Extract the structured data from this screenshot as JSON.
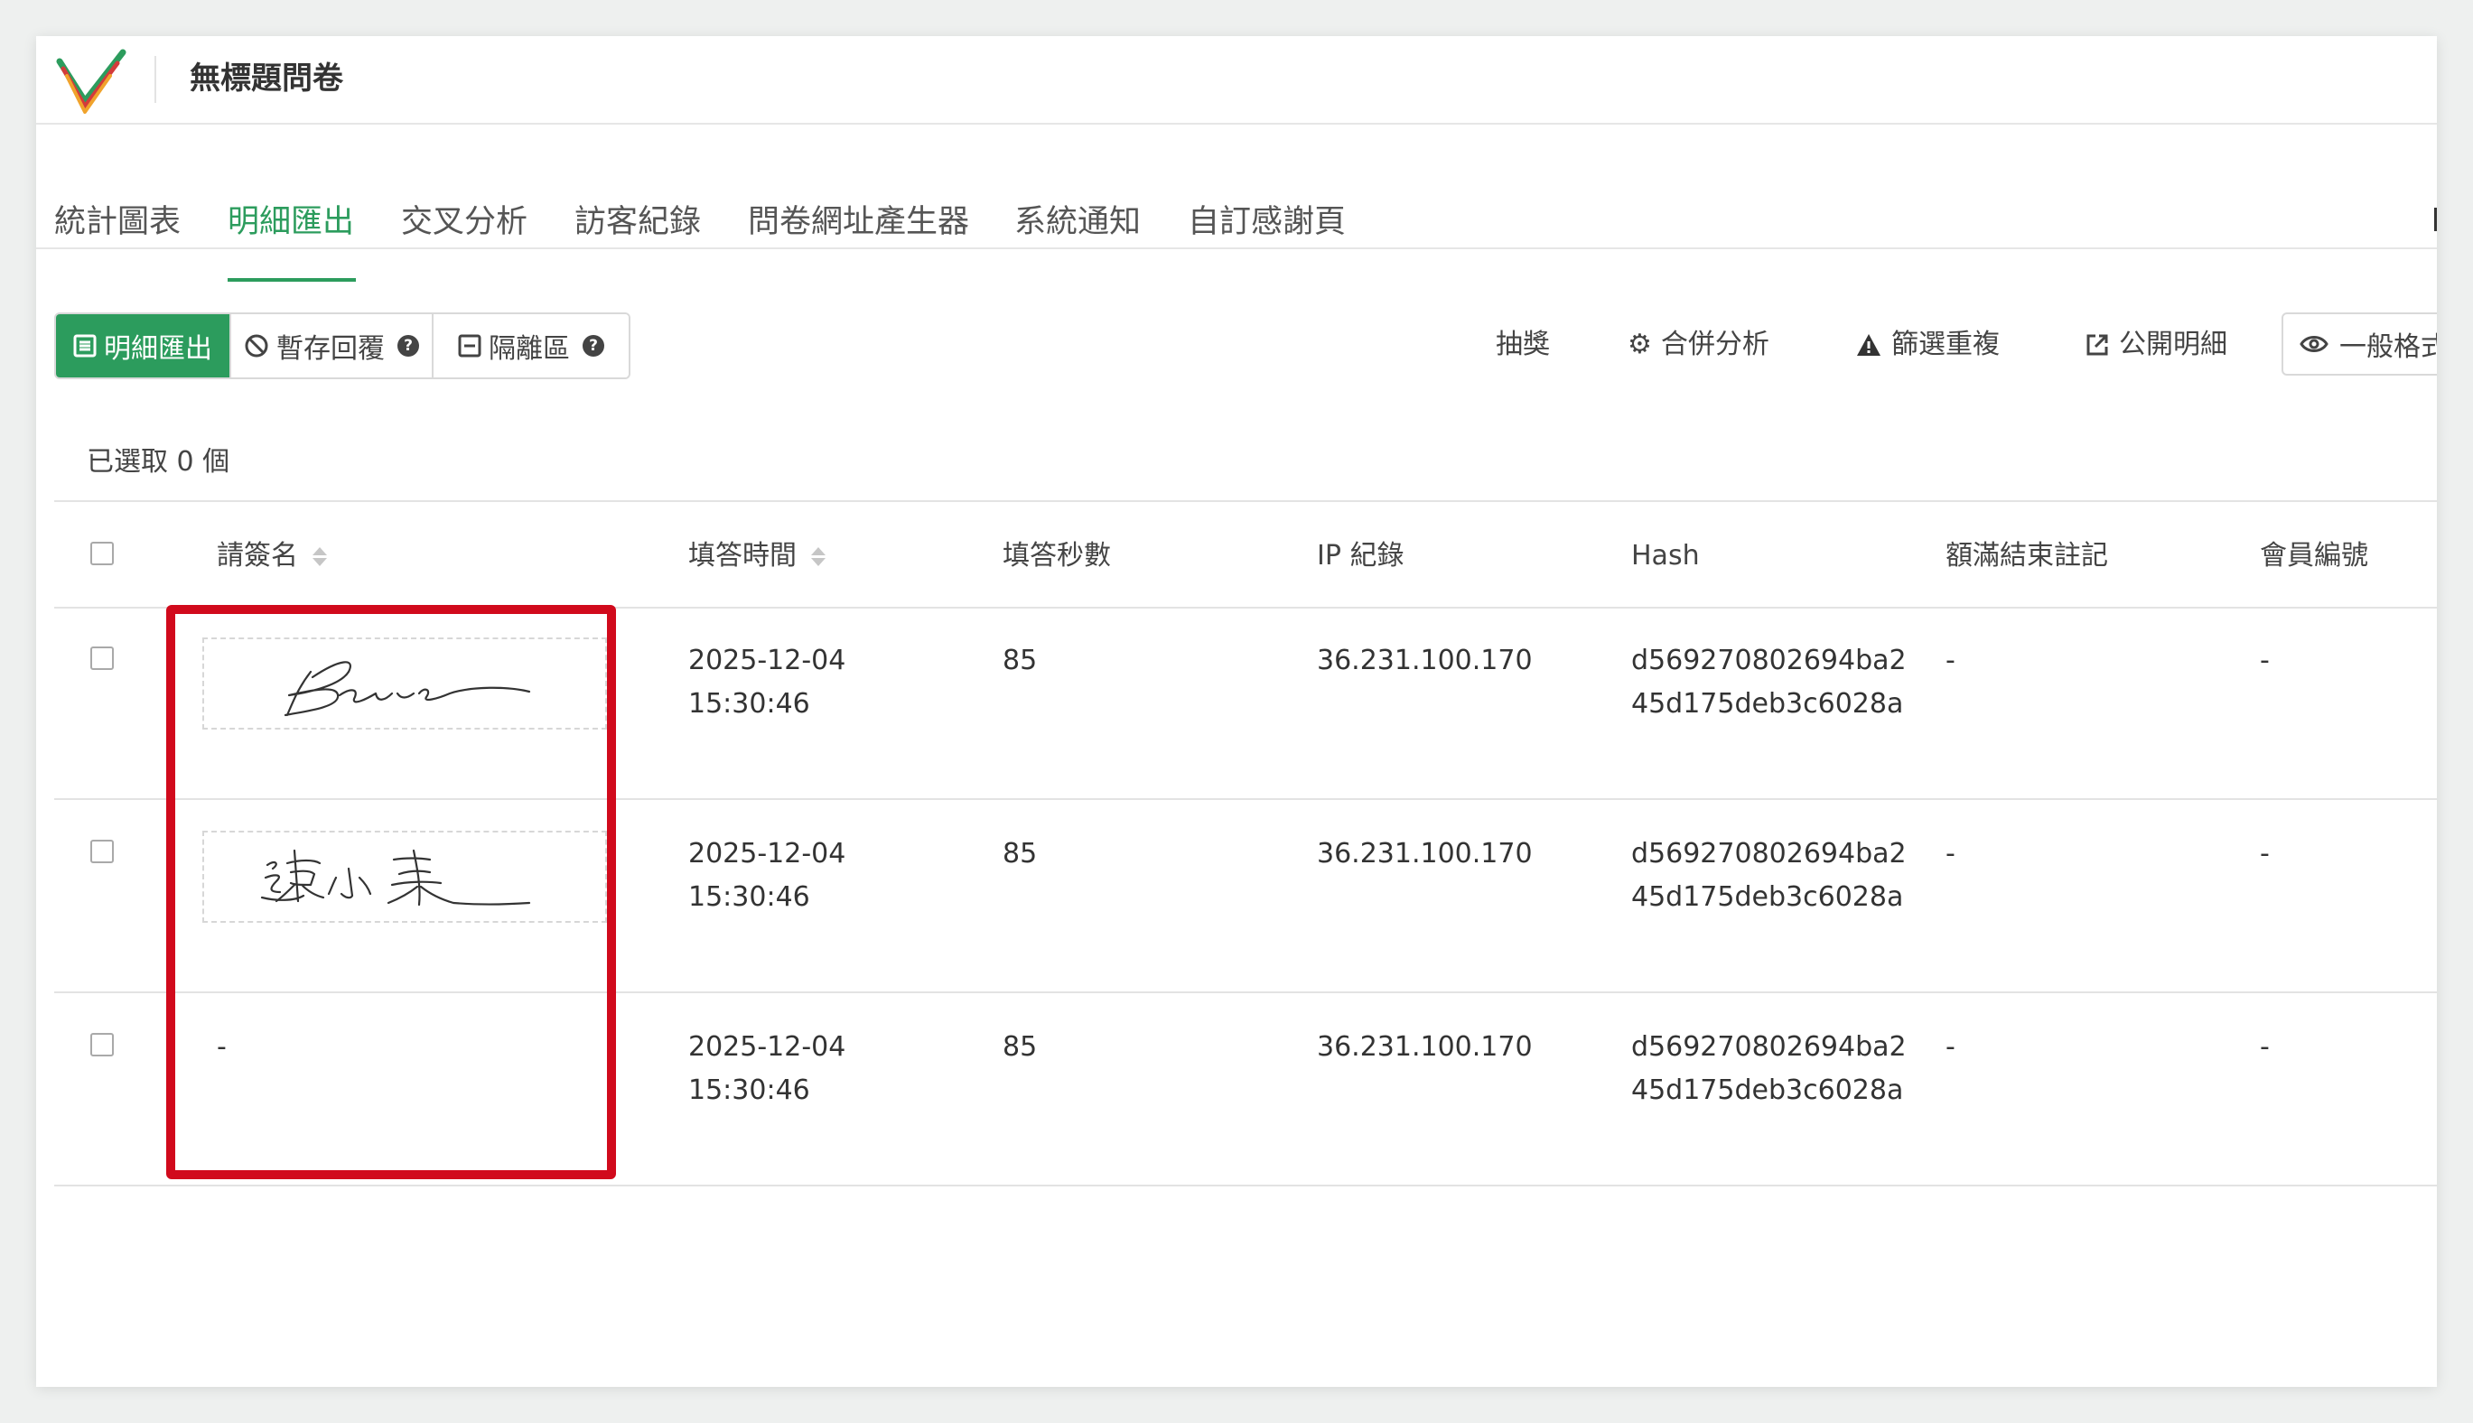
{
  "header": {
    "title": "無標題問卷"
  },
  "tabs": [
    {
      "label": "統計圖表"
    },
    {
      "label": "明細匯出",
      "active": true
    },
    {
      "label": "交叉分析"
    },
    {
      "label": "訪客紀錄"
    },
    {
      "label": "問卷網址產生器"
    },
    {
      "label": "系統通知"
    },
    {
      "label": "自訂感謝頁"
    }
  ],
  "toolbar": {
    "export_label": "明細匯出",
    "draft_label": "暫存回覆",
    "quarantine_label": "隔離區",
    "lottery_label": "抽獎",
    "merge_label": "合併分析",
    "dedupe_label": "篩選重複",
    "public_label": "公開明細",
    "format_label": "一般格式"
  },
  "selection": {
    "text": "已選取 0 個"
  },
  "table": {
    "columns": [
      "請簽名",
      "填答時間",
      "填答秒數",
      "IP 紀錄",
      "Hash",
      "額滿結束註記",
      "會員編號"
    ],
    "rows": [
      {
        "signature": "signature-image-1",
        "time_date": "2025-12-04",
        "time_clock": "15:30:46",
        "seconds": "85",
        "ip": "36.231.100.170",
        "hash_line1": "d569270802694ba2",
        "hash_line2": "45d175deb3c6028a",
        "full_note": "-",
        "member_id": "-"
      },
      {
        "signature": "signature-image-2",
        "time_date": "2025-12-04",
        "time_clock": "15:30:46",
        "seconds": "85",
        "ip": "36.231.100.170",
        "hash_line1": "d569270802694ba2",
        "hash_line2": "45d175deb3c6028a",
        "full_note": "-",
        "member_id": "-"
      },
      {
        "signature_text": "-",
        "time_date": "2025-12-04",
        "time_clock": "15:30:46",
        "seconds": "85",
        "ip": "36.231.100.170",
        "hash_line1": "d569270802694ba2",
        "hash_line2": "45d175deb3c6028a",
        "full_note": "-",
        "member_id": "-"
      }
    ]
  },
  "colors": {
    "accent": "#2c9c5d",
    "highlight": "#d10a1c"
  }
}
